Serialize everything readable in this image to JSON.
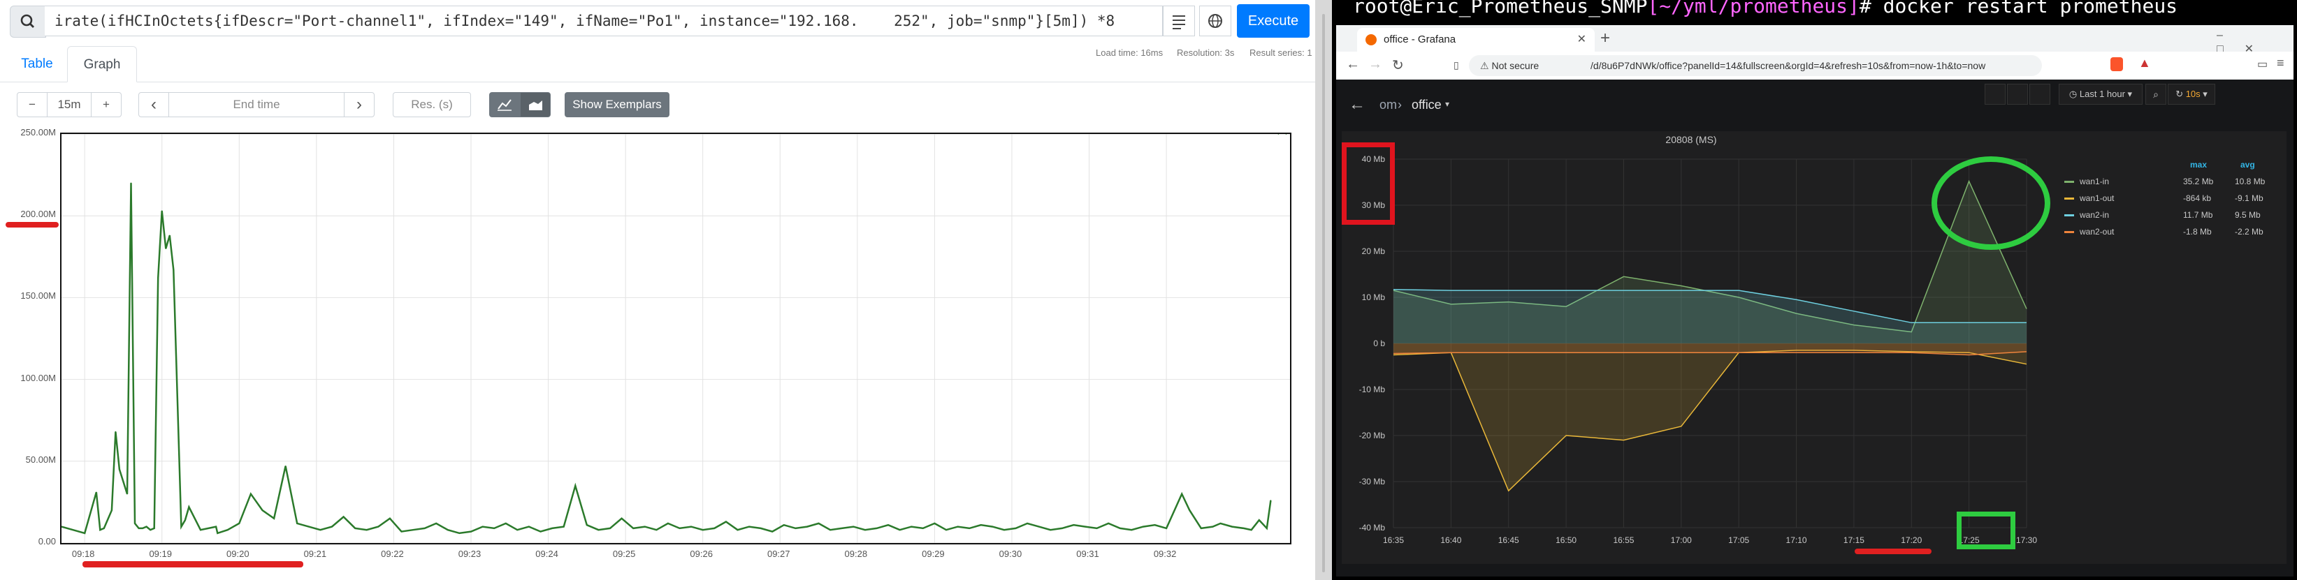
{
  "prometheus": {
    "query": "irate(ifHCInOctets{ifDescr=\"Port-channel1\", ifIndex=\"149\", ifName=\"Po1\", instance=\"192.168.    252\", job=\"snmp\"}[5m]) *8",
    "execute_label": "Execute",
    "stats": {
      "load_time": "Load time: 16ms",
      "resolution": "Resolution: 3s",
      "result_series": "Result series: 1"
    },
    "tabs": [
      "Table",
      "Graph"
    ],
    "active_tab": "Graph",
    "range_value": "15m",
    "end_time_placeholder": "End time",
    "res_placeholder": "Res. (s)",
    "show_exemplars_label": "Show Exemplars",
    "minus_label": "−",
    "plus_label": "+",
    "prev_label": "‹",
    "next_label": "›",
    "icons": [
      "search-icon",
      "history-icon",
      "globe-icon",
      "line-chart-icon",
      "stacked-chart-icon"
    ]
  },
  "terminal": {
    "prompt_user": "root@Eric_Prometheus_SNMP",
    "prompt_path": "[~/yml/prometheus]",
    "prompt_sym": "# ",
    "command": "docker restart prometheus"
  },
  "browser": {
    "tab_title": "office - Grafana",
    "not_secure": "Not secure",
    "url": "/d/8u6P7dNWk/office?panelId=14&fullscreen&orgId=4&refresh=10s&from=now-1h&to=now"
  },
  "grafana": {
    "breadcrumb_root": "om",
    "breadcrumb_sep": "›",
    "dashboard": "office",
    "time_range": "Last 1 hour",
    "refresh": "10s",
    "legend_headers": {
      "max": "max",
      "avg": "avg"
    }
  },
  "chart_data": [
    {
      "type": "line",
      "title": "",
      "xlabel": "",
      "ylabel": "",
      "ylim": [
        0,
        250000000
      ],
      "yticks": [
        "0.00",
        "50.00M",
        "100.00M",
        "150.00M",
        "200.00M",
        "250.00M"
      ],
      "xticks": [
        "09:18",
        "09:19",
        "09:20",
        "09:21",
        "09:22",
        "09:23",
        "09:24",
        "09:25",
        "09:26",
        "09:27",
        "09:28",
        "09:29",
        "09:30",
        "09:31",
        "09:32"
      ],
      "grid": true,
      "color": "#2b7a2b",
      "x_minutes": [
        0,
        0.3,
        0.45,
        0.5,
        0.55,
        0.65,
        0.7,
        0.75,
        0.85,
        0.9,
        0.95,
        1.0,
        1.05,
        1.1,
        1.15,
        1.2,
        1.25,
        1.3,
        1.35,
        1.4,
        1.45,
        1.55,
        1.6,
        1.65,
        1.8,
        2.0,
        2.02,
        2.15,
        2.3,
        2.45,
        2.6,
        2.75,
        2.9,
        3.05,
        3.2,
        3.35,
        3.5,
        3.65,
        3.8,
        3.95,
        4.1,
        4.25,
        4.4,
        4.55,
        4.7,
        4.85,
        5.0,
        5.15,
        5.3,
        5.45,
        5.6,
        5.75,
        5.9,
        6.05,
        6.2,
        6.35,
        6.5,
        6.65,
        6.8,
        6.95,
        7.1,
        7.25,
        7.4,
        7.55,
        7.7,
        7.85,
        8.0,
        8.15,
        8.3,
        8.45,
        8.6,
        8.75,
        8.9,
        9.05,
        9.2,
        9.35,
        9.5,
        9.65,
        9.8,
        9.95,
        10.1,
        10.25,
        10.4,
        10.55,
        10.7,
        10.85,
        11.0,
        11.15,
        11.3,
        11.45,
        11.6,
        11.75,
        11.9,
        12.05,
        12.2,
        12.35,
        12.5,
        12.65,
        12.8,
        12.95,
        13.1,
        13.25,
        13.4,
        13.55,
        13.7,
        13.85,
        14.0,
        14.15,
        14.3,
        14.5,
        14.6,
        14.75,
        14.9,
        15.0,
        15.15,
        15.3,
        15.4,
        15.5,
        15.6,
        15.65,
        15.75,
        15.85
      ],
      "values": [
        10000000,
        6000000,
        31000000,
        8000000,
        9000000,
        20000000,
        68000000,
        45000000,
        30000000,
        220000000,
        12000000,
        9000000,
        9000000,
        10000000,
        8000000,
        9000000,
        162000000,
        203000000,
        180000000,
        188000000,
        167000000,
        10000000,
        14000000,
        22000000,
        8000000,
        10000000,
        6000000,
        8000000,
        12000000,
        30000000,
        20000000,
        15000000,
        47000000,
        12000000,
        10000000,
        8000000,
        10000000,
        16000000,
        9000000,
        8000000,
        10000000,
        15000000,
        7000000,
        8000000,
        9000000,
        12000000,
        8000000,
        6000000,
        7000000,
        10000000,
        9000000,
        12000000,
        8000000,
        10000000,
        7000000,
        9000000,
        10000000,
        35000000,
        11000000,
        8000000,
        9000000,
        15000000,
        9000000,
        10000000,
        8000000,
        12000000,
        9000000,
        10000000,
        8000000,
        9000000,
        13000000,
        8000000,
        10000000,
        9000000,
        7000000,
        11000000,
        9000000,
        10000000,
        12000000,
        8000000,
        9000000,
        10000000,
        8000000,
        9000000,
        11000000,
        8000000,
        10000000,
        9000000,
        12000000,
        8000000,
        10000000,
        9000000,
        11000000,
        10000000,
        8000000,
        9000000,
        12000000,
        10000000,
        8000000,
        9000000,
        11000000,
        10000000,
        9000000,
        12000000,
        9000000,
        8000000,
        10000000,
        11000000,
        9000000,
        30000000,
        20000000,
        9000000,
        10000000,
        12000000,
        10000000,
        9000000,
        8000000,
        14000000,
        9000000,
        26000000
      ]
    },
    {
      "type": "area",
      "title": "20808 (MS)",
      "xlabel": "",
      "ylabel": "",
      "ylim": [
        -40,
        40
      ],
      "yticks": [
        "-40 Mb",
        "-30 Mb",
        "-20 Mb",
        "-10 Mb",
        "0 b",
        "10 Mb",
        "20 Mb",
        "30 Mb",
        "40 Mb"
      ],
      "categories": [
        "16:35",
        "16:40",
        "16:45",
        "16:50",
        "16:55",
        "17:00",
        "17:05",
        "17:10",
        "17:15",
        "17:20",
        "17:25",
        "17:30"
      ],
      "grid": true,
      "legend_position": "right",
      "series": [
        {
          "name": "wan1-in",
          "color": "#7eb26d",
          "max": "35.2 Mb",
          "avg": "10.8 Mb",
          "values": [
            11.5,
            8.5,
            9.0,
            8.0,
            14.5,
            12.5,
            10.0,
            6.5,
            4.0,
            2.5,
            35.2,
            7.5
          ]
        },
        {
          "name": "wan1-out",
          "color": "#eab839",
          "max": "-864 kb",
          "avg": "-9.1 Mb",
          "values": [
            -2.5,
            -2.0,
            -32.0,
            -20.0,
            -21.0,
            -18.0,
            -2.0,
            -1.5,
            -1.5,
            -1.8,
            -2.0,
            -4.5
          ]
        },
        {
          "name": "wan2-in",
          "color": "#6ed0e0",
          "max": "11.7 Mb",
          "avg": "9.5 Mb",
          "values": [
            11.7,
            11.5,
            11.5,
            11.5,
            11.5,
            11.5,
            11.5,
            9.5,
            7.0,
            4.5,
            4.5,
            4.5
          ]
        },
        {
          "name": "wan2-out",
          "color": "#ef843c",
          "max": "-1.8 Mb",
          "avg": "-2.2 Mb",
          "values": [
            -2.2,
            -2.0,
            -2.0,
            -2.0,
            -2.0,
            -2.0,
            -2.0,
            -2.0,
            -2.0,
            -2.0,
            -2.5,
            -1.8
          ]
        }
      ]
    }
  ]
}
